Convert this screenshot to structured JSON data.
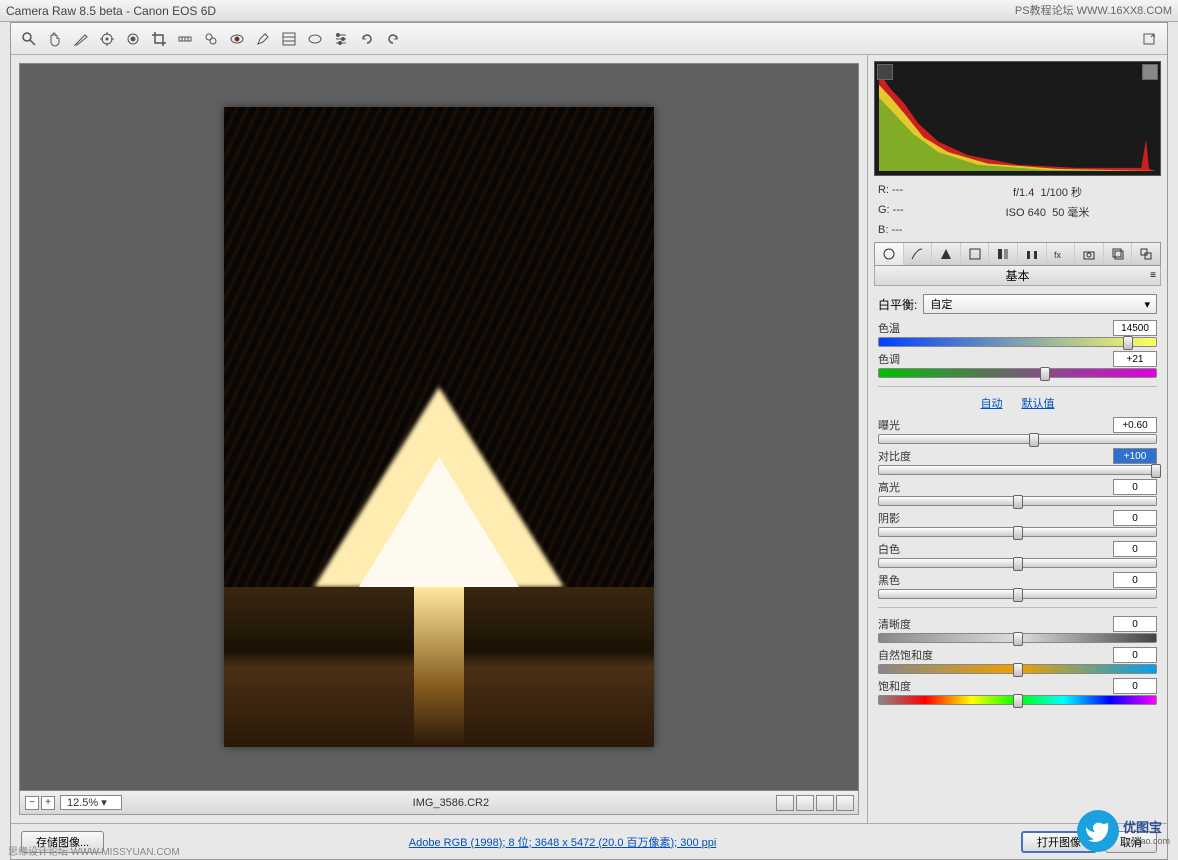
{
  "title": "Camera Raw 8.5 beta - Canon EOS 6D",
  "watermark_top": "PS教程论坛 WWW.16XX8.COM",
  "footer_credit": "思缘设计论坛 WWW.MISSYUAN.COM",
  "preview": {
    "zoom": "12.5%",
    "filename": "IMG_3586.CR2"
  },
  "meta": {
    "r": "R: ---",
    "g": "G: ---",
    "b": "B: ---",
    "aperture": "f/1.4",
    "shutter": "1/100 秒",
    "iso": "ISO 640",
    "focal": "50 毫米"
  },
  "panel": {
    "title": "基本",
    "wb_label": "白平衡:",
    "wb_value": "自定",
    "auto": "自动",
    "default": "默认值",
    "sliders": {
      "temp": {
        "label": "色温",
        "value": "14500",
        "pos": 90
      },
      "tint": {
        "label": "色调",
        "value": "+21",
        "pos": 60
      },
      "exposure": {
        "label": "曝光",
        "value": "+0.60",
        "pos": 56
      },
      "contrast": {
        "label": "对比度",
        "value": "+100",
        "pos": 100
      },
      "highlights": {
        "label": "高光",
        "value": "0",
        "pos": 50
      },
      "shadows": {
        "label": "阴影",
        "value": "0",
        "pos": 50
      },
      "whites": {
        "label": "白色",
        "value": "0",
        "pos": 50
      },
      "blacks": {
        "label": "黑色",
        "value": "0",
        "pos": 50
      },
      "clarity": {
        "label": "清晰度",
        "value": "0",
        "pos": 50
      },
      "vibrance": {
        "label": "自然饱和度",
        "value": "0",
        "pos": 50
      },
      "saturation": {
        "label": "饱和度",
        "value": "0",
        "pos": 50
      }
    }
  },
  "bottom": {
    "save_image": "存储图像...",
    "info": "Adobe RGB (1998); 8 位; 3648 x 5472 (20.0 百万像素); 300 ppi",
    "open_image": "打开图像",
    "cancel": "取消"
  },
  "wm_logo": {
    "name": "优图宝",
    "url": "utobao.com"
  }
}
